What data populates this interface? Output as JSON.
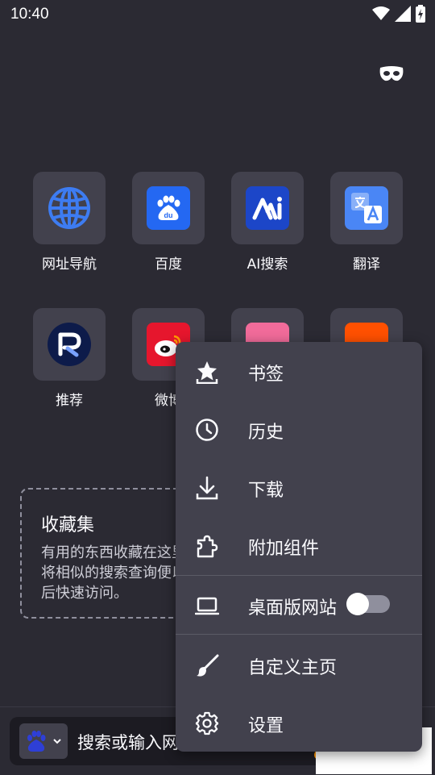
{
  "status_bar": {
    "time": "10:40"
  },
  "shortcuts": [
    {
      "label": "网址导航",
      "icon": "globe-icon"
    },
    {
      "label": "百度",
      "icon": "baidu-logo"
    },
    {
      "label": "AI搜索",
      "icon": "ai-search-logo"
    },
    {
      "label": "翻译",
      "icon": "translate-logo"
    },
    {
      "label": "推荐",
      "icon": "recommend-logo"
    },
    {
      "label": "微博",
      "icon": "weibo-logo"
    },
    {
      "label": "",
      "icon": "bilibili-logo"
    },
    {
      "label": "",
      "icon": "taobao-logo"
    }
  ],
  "collection": {
    "title": "收藏集",
    "description": "有用的东西收藏在这里将相似的搜索查询便以后快速访问。"
  },
  "url_bar": {
    "placeholder": "搜索或输入网址"
  },
  "menu": {
    "items": [
      {
        "label": "书签",
        "icon": "star-icon"
      },
      {
        "label": "历史",
        "icon": "clock-icon"
      },
      {
        "label": "下载",
        "icon": "download-icon"
      },
      {
        "label": "附加组件",
        "icon": "puzzle-icon"
      },
      {
        "label": "桌面版网站",
        "icon": "laptop-icon",
        "toggle": false
      },
      {
        "label": "自定义主页",
        "icon": "brush-icon"
      },
      {
        "label": "设置",
        "icon": "gear-icon"
      }
    ]
  },
  "colors": {
    "background": "#2b2a33",
    "menu": "#42414d",
    "baidu_blue": "#2468f2",
    "accent_orange": "#ff9400"
  }
}
